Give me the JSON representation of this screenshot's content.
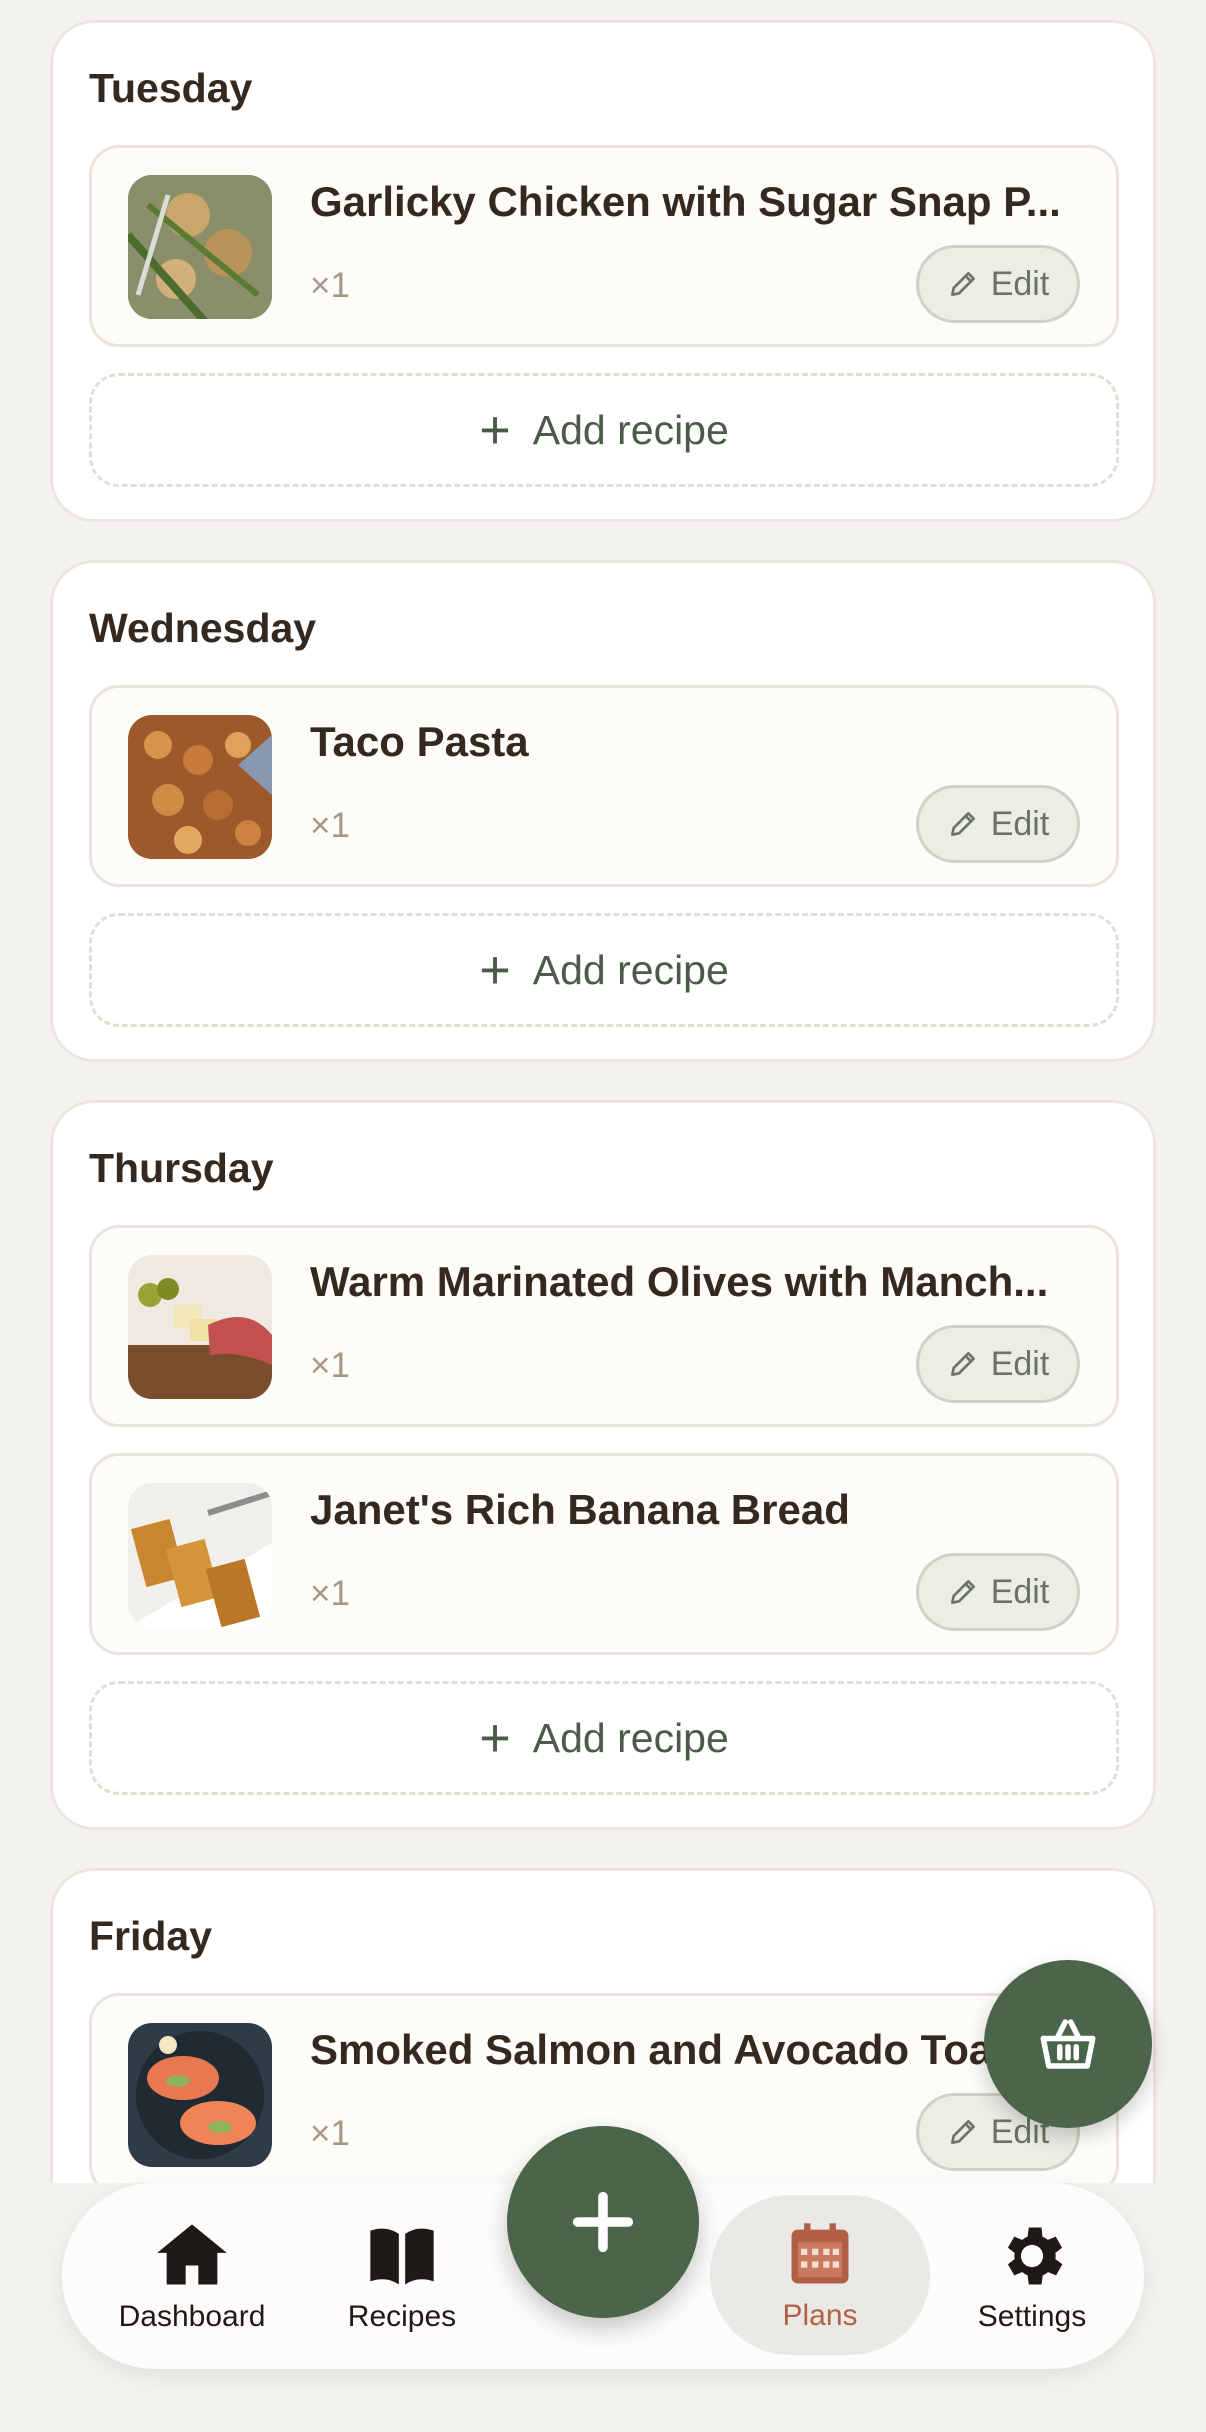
{
  "days": [
    {
      "title": "Tuesday",
      "recipes": [
        {
          "name": "Garlicky Chicken with Sugar Snap P...",
          "qty": "×1",
          "edit": "Edit"
        }
      ],
      "add_label": "Add recipe"
    },
    {
      "title": "Wednesday",
      "recipes": [
        {
          "name": "Taco Pasta",
          "qty": "×1",
          "edit": "Edit"
        }
      ],
      "add_label": "Add recipe"
    },
    {
      "title": "Thursday",
      "recipes": [
        {
          "name": "Warm Marinated Olives with Manch...",
          "qty": "×1",
          "edit": "Edit"
        },
        {
          "name": "Janet's Rich Banana Bread",
          "qty": "×1",
          "edit": "Edit"
        }
      ],
      "add_label": "Add recipe"
    },
    {
      "title": "Friday",
      "recipes": [
        {
          "name": "Smoked Salmon and Avocado Toast",
          "qty": "×1",
          "edit": "Edit"
        }
      ]
    }
  ],
  "nav": {
    "dashboard": "Dashboard",
    "recipes": "Recipes",
    "plans": "Plans",
    "settings": "Settings"
  },
  "icons": {
    "cart": "basket-icon",
    "add": "plus-icon",
    "edit": "pencil-icon"
  },
  "colors": {
    "accent_green": "#4a6549",
    "active_tab": "#b35f43",
    "background": "#f4f2ee"
  }
}
